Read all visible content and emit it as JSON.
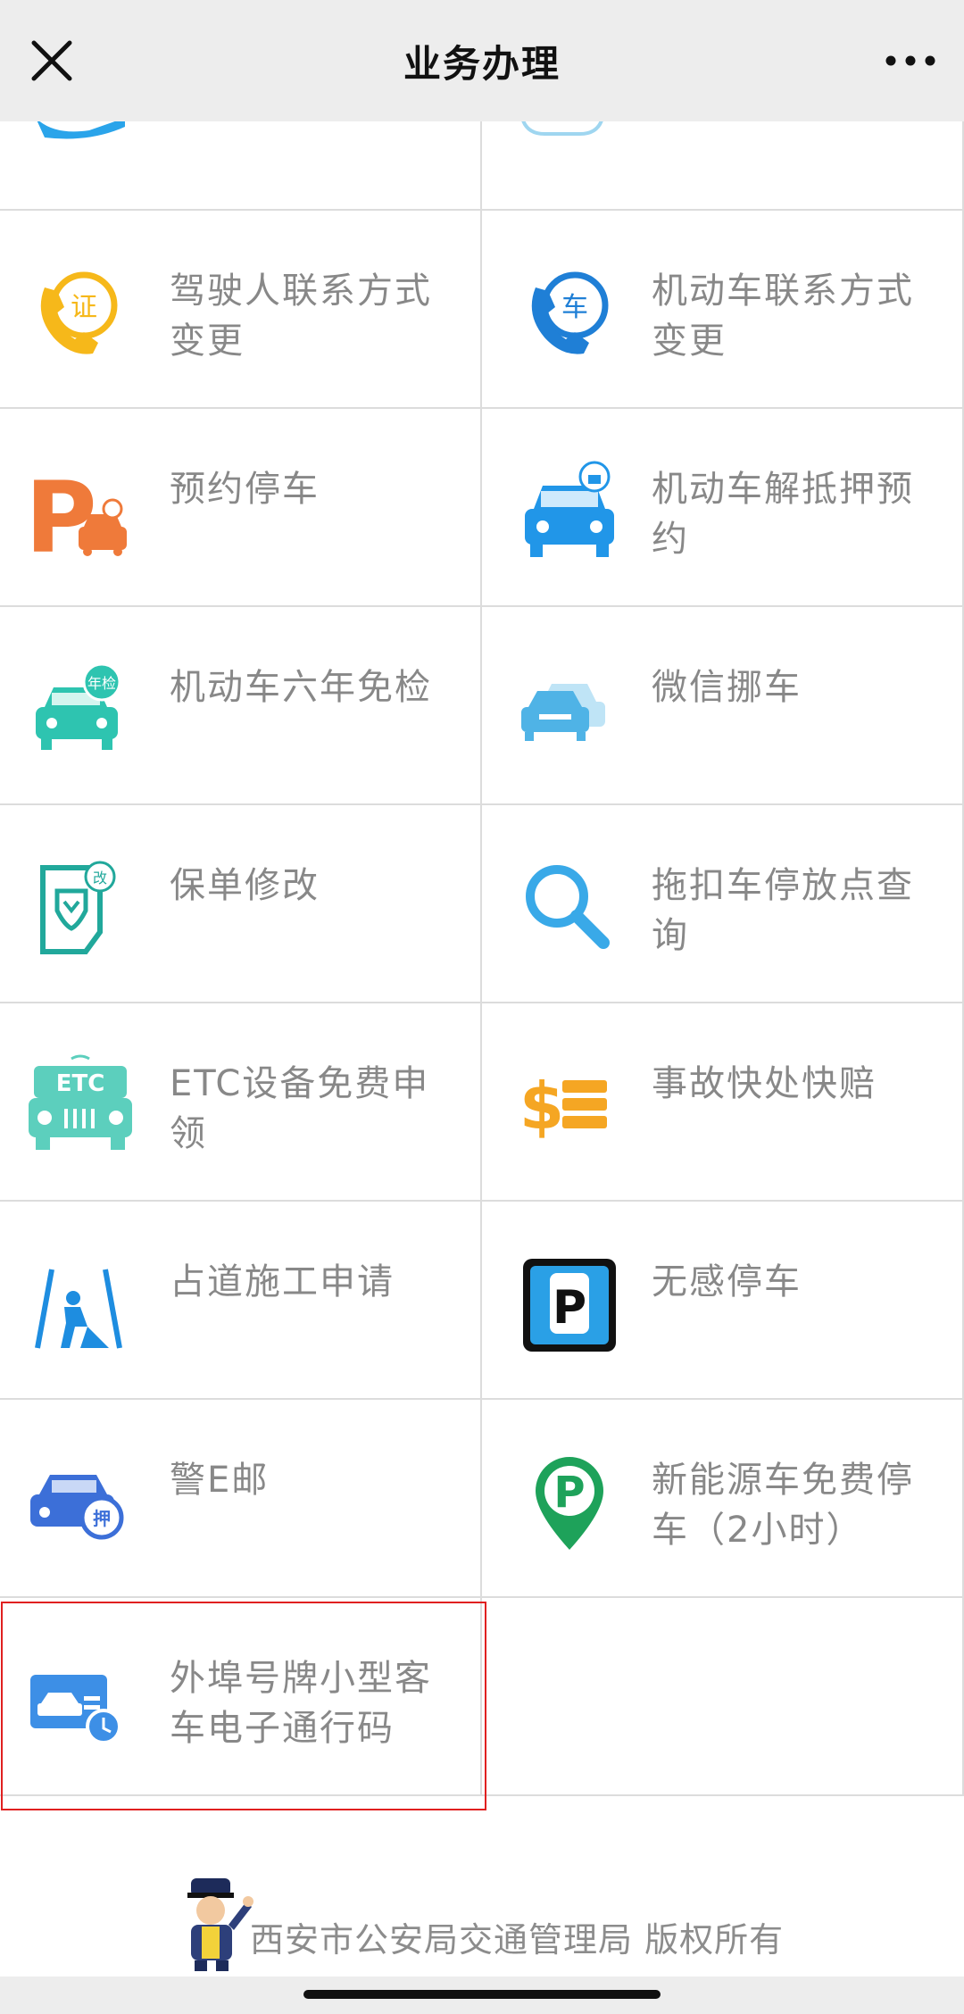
{
  "nav": {
    "title": "业务办理",
    "close_icon": "close-icon",
    "more_icon": "more-icon"
  },
  "items": [
    {
      "label": "驾驶人联系方式变更",
      "icon": "phone-license-icon",
      "color": "#f6b81a"
    },
    {
      "label": "机动车联系方式变更",
      "icon": "phone-car-icon",
      "color": "#1f7fd6"
    },
    {
      "label": "预约停车",
      "icon": "parking-reserve-icon",
      "color": "#ef7a3a"
    },
    {
      "label": "机动车解抵押预约",
      "icon": "car-unlock-icon",
      "color": "#2196e8"
    },
    {
      "label": "机动车六年免检",
      "icon": "car-inspection-icon",
      "color": "#2ec4b0"
    },
    {
      "label": "微信挪车",
      "icon": "move-car-icon",
      "color": "#4fb3e6"
    },
    {
      "label": "保单修改",
      "icon": "policy-edit-icon",
      "color": "#21a89b"
    },
    {
      "label": "拖扣车停放点查询",
      "icon": "search-icon",
      "color": "#39a9e8"
    },
    {
      "label": "ETC设备免费申领",
      "icon": "etc-car-icon",
      "color": "#5ccfbd"
    },
    {
      "label": "事故快处快赔",
      "icon": "dollar-icon",
      "color": "#f5a623"
    },
    {
      "label": "占道施工申请",
      "icon": "road-work-icon",
      "color": "#1e8de0"
    },
    {
      "label": "无感停车",
      "icon": "parking-sign-icon",
      "color": "#2aa0e6"
    },
    {
      "label": "警E邮",
      "icon": "car-mortgage-icon",
      "color": "#3c6fd8"
    },
    {
      "label": "新能源车免费停车（2小时）",
      "icon": "ev-parking-pin-icon",
      "color": "#1ea25a"
    },
    {
      "label": "外埠号牌小型客车电子通行码",
      "icon": "pass-card-icon",
      "color": "#3d8fe6"
    }
  ],
  "footer": {
    "text": "西安市公安局交通管理局 版权所有",
    "mascot_icon": "police-mascot-icon"
  }
}
